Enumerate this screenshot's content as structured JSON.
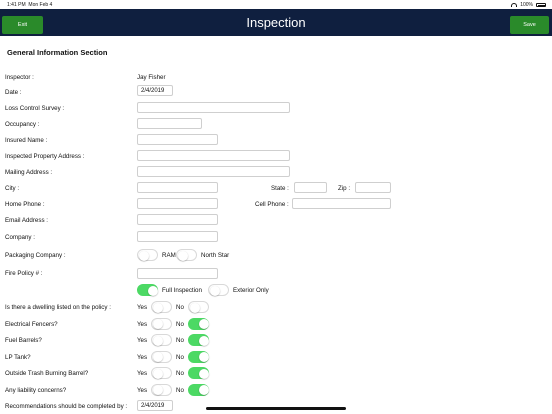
{
  "status": {
    "time": "1:41 PM",
    "date": "Mon Feb 4",
    "battery": "100%"
  },
  "header": {
    "title": "Inspection",
    "exit_label": "Exit",
    "save_label": "Save",
    "accent": "#2a8a2a",
    "bar_color": "#0f1f3f"
  },
  "form": {
    "section_title": "General Information Section",
    "inspector_label": "Inspector :",
    "inspector_value": "Jay Fisher",
    "date_label": "Date :",
    "date_value": "2/4/2019",
    "loss_control_label": "Loss Control Survey :",
    "occupancy_label": "Occupancy :",
    "insured_name_label": "Insured Name :",
    "inspected_address_label": "Inspected Property Address :",
    "mailing_address_label": "Mailing Address :",
    "city_label": "City :",
    "state_label": "State :",
    "zip_label": "Zip :",
    "home_phone_label": "Home Phone :",
    "cell_phone_label": "Cell Phone :",
    "email_label": "Email Address :",
    "company_label": "Company :",
    "packaging_label": "Packaging Company :",
    "packaging_option_1": "RAM",
    "packaging_option_2": "North Star",
    "fire_policy_label": "Fire Policy # :",
    "full_inspection_label": "Full Inspection",
    "exterior_only_label": "Exterior Only",
    "yes_label": "Yes",
    "no_label": "No",
    "questions": [
      {
        "label": "Is there a dwelling listed on the policy :",
        "answer": "none"
      },
      {
        "label": "Electrical Fencers?",
        "answer": "no"
      },
      {
        "label": "Fuel Barrels?",
        "answer": "no"
      },
      {
        "label": "LP Tank?",
        "answer": "no"
      },
      {
        "label": "Outside Trash Burning Barrel?",
        "answer": "no"
      },
      {
        "label": "Any liability concerns?",
        "answer": "no"
      }
    ],
    "recommendations_label": "Recommendations should be completed by :",
    "recommendations_date": "2/4/2019"
  }
}
